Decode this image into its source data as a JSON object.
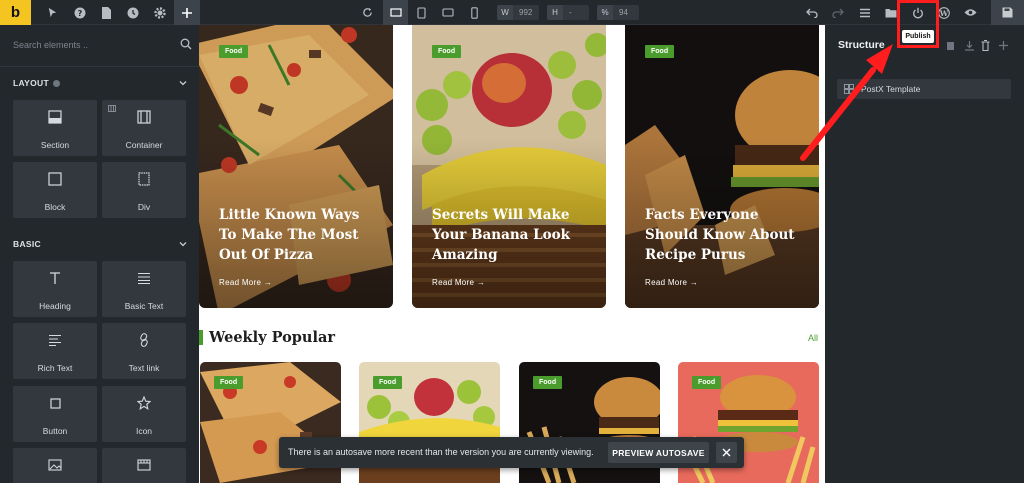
{
  "app": {
    "logo_letter": "b"
  },
  "toolbar": {
    "width_label": "W",
    "width_value": "992",
    "height_label": "H",
    "height_value": "-",
    "zoom_label": "%",
    "zoom_value": "94",
    "publish_tooltip": "Publish"
  },
  "sidebar": {
    "search_placeholder": "Search elements ..",
    "categories": [
      {
        "title": "LAYOUT",
        "items": [
          "Section",
          "Container",
          "Block",
          "Div"
        ]
      },
      {
        "title": "BASIC",
        "items": [
          "Heading",
          "Basic Text",
          "Rich Text",
          "Text link",
          "Button",
          "Icon"
        ]
      }
    ]
  },
  "canvas": {
    "featured": [
      {
        "badge": "Food",
        "title": "Little Known Ways To Make The Most Out Of Pizza",
        "read_more": "Read More"
      },
      {
        "badge": "Food",
        "title": "Secrets Will Make Your Banana Look Amazing",
        "read_more": "Read More"
      },
      {
        "badge": "Food",
        "title": "Facts Everyone Should Know About Recipe Purus",
        "read_more": "Read More"
      }
    ],
    "section_title": "Weekly Popular",
    "all_link": "All",
    "popular_badges": [
      "Food",
      "Food",
      "Food",
      "Food"
    ]
  },
  "toast": {
    "message": "There is an autosave more recent than the version you are currently viewing.",
    "button": "PREVIEW AUTOSAVE"
  },
  "structure": {
    "title": "Structure",
    "tree_item": "PostX Template"
  },
  "colors": {
    "accent_green": "#4a9c2c",
    "annotation_red": "#ff1d1d",
    "logo_yellow": "#f4c521"
  }
}
